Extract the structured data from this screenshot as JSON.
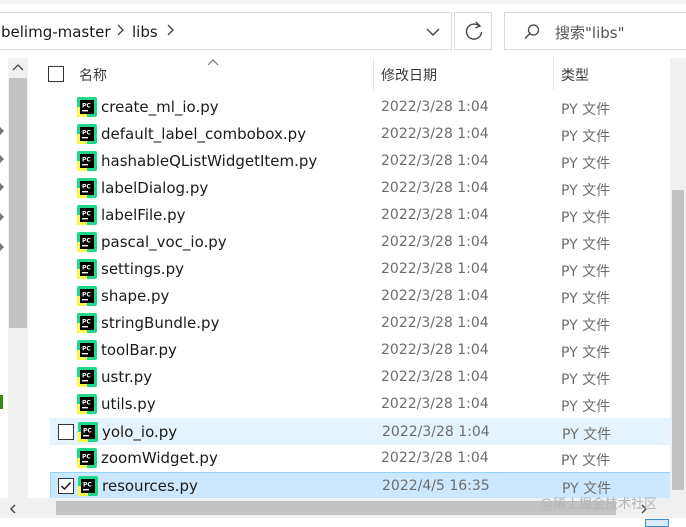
{
  "address_bar": {
    "crumbs": [
      "belimg-master",
      "libs"
    ]
  },
  "search": {
    "placeholder": "搜索\"libs\""
  },
  "columns": {
    "name": "名称",
    "modified": "修改日期",
    "type": "类型"
  },
  "files": [
    {
      "name": "create_ml_io.py",
      "date": "2022/3/28 1:04",
      "type": "PY 文件"
    },
    {
      "name": "default_label_combobox.py",
      "date": "2022/3/28 1:04",
      "type": "PY 文件"
    },
    {
      "name": "hashableQListWidgetItem.py",
      "date": "2022/3/28 1:04",
      "type": "PY 文件"
    },
    {
      "name": "labelDialog.py",
      "date": "2022/3/28 1:04",
      "type": "PY 文件"
    },
    {
      "name": "labelFile.py",
      "date": "2022/3/28 1:04",
      "type": "PY 文件"
    },
    {
      "name": "pascal_voc_io.py",
      "date": "2022/3/28 1:04",
      "type": "PY 文件"
    },
    {
      "name": "settings.py",
      "date": "2022/3/28 1:04",
      "type": "PY 文件"
    },
    {
      "name": "shape.py",
      "date": "2022/3/28 1:04",
      "type": "PY 文件"
    },
    {
      "name": "stringBundle.py",
      "date": "2022/3/28 1:04",
      "type": "PY 文件"
    },
    {
      "name": "toolBar.py",
      "date": "2022/3/28 1:04",
      "type": "PY 文件"
    },
    {
      "name": "ustr.py",
      "date": "2022/3/28 1:04",
      "type": "PY 文件"
    },
    {
      "name": "utils.py",
      "date": "2022/3/28 1:04",
      "type": "PY 文件"
    },
    {
      "name": "yolo_io.py",
      "date": "2022/3/28 1:04",
      "type": "PY 文件",
      "state": "hover"
    },
    {
      "name": "zoomWidget.py",
      "date": "2022/3/28 1:04",
      "type": "PY 文件"
    },
    {
      "name": "resources.py",
      "date": "2022/4/5 16:35",
      "type": "PY 文件",
      "state": "selected"
    }
  ],
  "watermark": "@稀土掘金技术社区",
  "icons": {
    "file": "pycharm-file-icon",
    "refresh": "refresh-icon",
    "search": "search-icon",
    "dropdown": "chevron-down-icon",
    "separator": "chevron-right-icon"
  },
  "colors": {
    "hover_row": "#e5f3ff",
    "selected_row": "#cce8ff",
    "selected_border": "#99d1ff"
  }
}
